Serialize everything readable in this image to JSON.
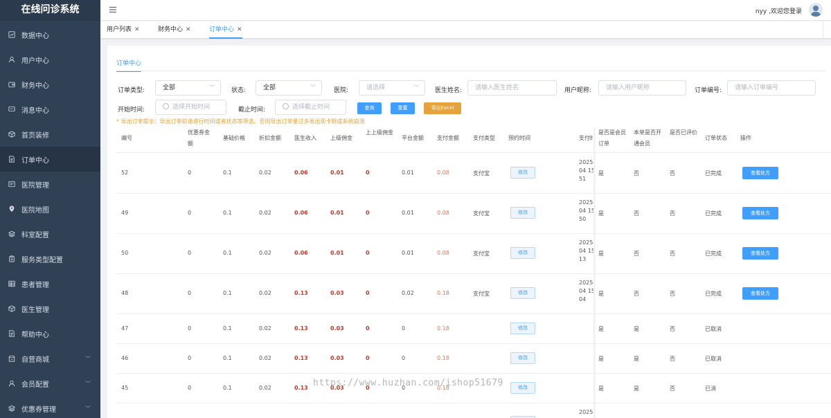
{
  "app": {
    "title": "在线问诊系统"
  },
  "sidebar": {
    "items": [
      {
        "label": "数据中心",
        "icon": "chart-icon"
      },
      {
        "label": "用户中心",
        "icon": "user-icon"
      },
      {
        "label": "财务中心",
        "icon": "wallet-icon"
      },
      {
        "label": "消息中心",
        "icon": "message-icon"
      },
      {
        "label": "首页装修",
        "icon": "cube-icon"
      },
      {
        "label": "订单中心",
        "icon": "document-icon",
        "active": true
      },
      {
        "label": "医院管理",
        "icon": "board-icon"
      },
      {
        "label": "医院地图",
        "icon": "location-icon"
      },
      {
        "label": "科室配置",
        "icon": "layers-icon"
      },
      {
        "label": "服务类型配置",
        "icon": "clipboard-icon"
      },
      {
        "label": "患者管理",
        "icon": "grid-icon"
      },
      {
        "label": "医生管理",
        "icon": "cube-icon"
      },
      {
        "label": "帮助中心",
        "icon": "document-icon"
      },
      {
        "label": "自营商城",
        "icon": "shop-icon",
        "expandable": true
      },
      {
        "label": "会员配置",
        "icon": "user-icon",
        "expandable": true
      },
      {
        "label": "优惠券管理",
        "icon": "layers-icon",
        "expandable": true
      }
    ]
  },
  "header": {
    "user_text": "nyy ,欢迎您登录"
  },
  "tabs": [
    {
      "label": "用户列表"
    },
    {
      "label": "财务中心"
    },
    {
      "label": "订单中心",
      "active": true
    }
  ],
  "main": {
    "inner_tab": "订单中心",
    "filters": {
      "order_type_label": "订单类型:",
      "order_type_value": "全部",
      "status_label": "状态:",
      "status_value": "全部",
      "hospital_label": "医院:",
      "hospital_placeholder": "请选择",
      "doctor_label": "医生姓名:",
      "doctor_placeholder": "请输入医生姓名",
      "nickname_label": "用户昵称:",
      "nickname_placeholder": "请输入用户昵称",
      "order_no_label": "订单编号:",
      "order_no_placeholder": "请输入订单编号",
      "start_label": "开始时间:",
      "start_placeholder": "选择开始时间",
      "end_label": "截止时间:",
      "end_placeholder": "选择截止时间",
      "query_button": "查询",
      "reset_button": "重置",
      "export_button": "导出Excel"
    },
    "tip": "* 导出订单提示：导出订单前请进行时间或者状态等筛选。否则导出订单量过多易出现卡顿或系统崩溃"
  },
  "table": {
    "headers": {
      "id": "编号",
      "coupon": "优惠券金额",
      "base_price": "基础价格",
      "discount": "折扣金额",
      "doctor_income": "医生收入",
      "upper_commission": "上级佣金",
      "upper_upper_commission": "上上级佣金",
      "platform_amount": "平台金额",
      "paid_amount": "支付金额",
      "pay_type": "支付类型",
      "appointment": "预约时间",
      "pay_time": "支付时间",
      "is_member_order": "是否是会员订单",
      "opened_member": "本单是否开通会员",
      "reviewed": "是否已评价",
      "order_status": "订单状态",
      "action": "操作"
    },
    "modify_label": "修改",
    "view_label": "查看处方",
    "rows": [
      {
        "id": "52",
        "coupon": "0",
        "base_price": "0.1",
        "discount": "0.02",
        "doctor_income": "0.06",
        "upper_commission": "0.01",
        "upper_upper_commission": "0",
        "platform_amount": "0.01",
        "paid_amount": "0.08",
        "pay_type": "支付宝",
        "pay_time": [
          "2025-",
          "04 15",
          "51"
        ],
        "is_member_order": "是",
        "opened_member": "否",
        "reviewed": "否",
        "order_status": "已完成",
        "has_view": true
      },
      {
        "id": "49",
        "coupon": "0",
        "base_price": "0.1",
        "discount": "0.02",
        "doctor_income": "0.06",
        "upper_commission": "0.01",
        "upper_upper_commission": "0",
        "platform_amount": "0.01",
        "paid_amount": "0.08",
        "pay_type": "支付宝",
        "pay_time": [
          "2025-",
          "04 15",
          "50"
        ],
        "is_member_order": "是",
        "opened_member": "否",
        "reviewed": "否",
        "order_status": "已完成",
        "has_view": true
      },
      {
        "id": "50",
        "coupon": "0",
        "base_price": "0.1",
        "discount": "0.02",
        "doctor_income": "0.06",
        "upper_commission": "0.01",
        "upper_upper_commission": "0",
        "platform_amount": "0.01",
        "paid_amount": "0.08",
        "pay_type": "支付宝",
        "pay_time": [
          "2025-",
          "04 15",
          "13"
        ],
        "is_member_order": "是",
        "opened_member": "否",
        "reviewed": "否",
        "order_status": "已完成",
        "has_view": true
      },
      {
        "id": "48",
        "coupon": "0",
        "base_price": "0.1",
        "discount": "0.02",
        "doctor_income": "0.13",
        "upper_commission": "0.03",
        "upper_upper_commission": "0",
        "platform_amount": "0.02",
        "paid_amount": "0.18",
        "pay_type": "支付宝",
        "pay_time": [
          "2025-",
          "04 15",
          "04"
        ],
        "is_member_order": "是",
        "opened_member": "否",
        "reviewed": "否",
        "order_status": "已完成",
        "has_view": true
      },
      {
        "id": "47",
        "coupon": "0",
        "base_price": "0.1",
        "discount": "0.02",
        "doctor_income": "0.13",
        "upper_commission": "0.03",
        "upper_upper_commission": "0",
        "platform_amount": "0",
        "paid_amount": "0.18",
        "pay_type": "",
        "pay_time": [],
        "is_member_order": "是",
        "opened_member": "是",
        "reviewed": "否",
        "order_status": "已取消",
        "has_view": false
      },
      {
        "id": "46",
        "coupon": "0",
        "base_price": "0.1",
        "discount": "0.02",
        "doctor_income": "0.13",
        "upper_commission": "0.03",
        "upper_upper_commission": "0",
        "platform_amount": "0",
        "paid_amount": "0.18",
        "pay_type": "",
        "pay_time": [],
        "is_member_order": "是",
        "opened_member": "是",
        "reviewed": "否",
        "order_status": "已取消",
        "has_view": false
      },
      {
        "id": "45",
        "coupon": "0",
        "base_price": "0.1",
        "discount": "0.02",
        "doctor_income": "0.13",
        "upper_commission": "0.03",
        "upper_upper_commission": "0",
        "platform_amount": "0",
        "paid_amount": "0.18",
        "pay_type": "",
        "pay_time": [],
        "is_member_order": "是",
        "opened_member": "是",
        "reviewed": "否",
        "order_status": "已消",
        "has_view": false
      }
    ],
    "partial_row_pay_time": "2025-"
  },
  "watermark": "https://www.huzhan.com/ishop51679"
}
